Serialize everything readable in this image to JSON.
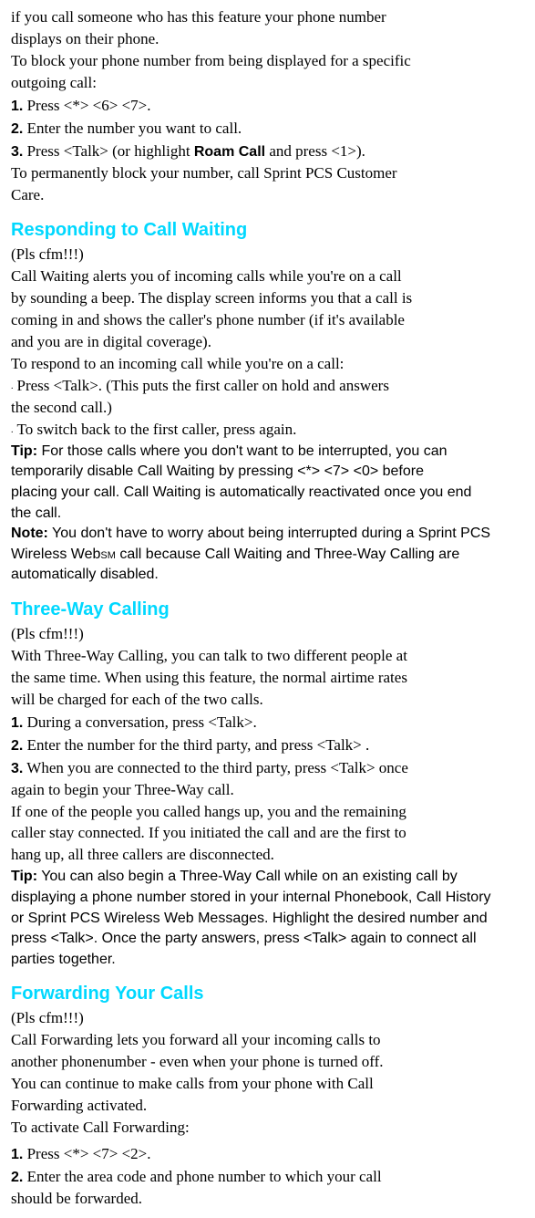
{
  "intro": {
    "l1": "if you call someone who has this feature your phone number",
    "l2": "displays on their phone.",
    "l3": "To block your phone number from being displayed for a specific",
    "l4": "outgoing call:",
    "s1n": "1.",
    "s1t": " Press <*> <6> <7>.",
    "s2n": "2.",
    "s2t": " Enter the number you want to call.",
    "s3n": "3.",
    "s3ta": " Press <Talk> (or highlight ",
    "s3tb": "Roam Call",
    "s3tc": " and press <1>).",
    "l5": "To permanently block your number, call Sprint PCS Customer",
    "l6": "Care."
  },
  "cw": {
    "heading": "Responding to Call Waiting",
    "pls": "(Pls cfm!!!)",
    "l1": "Call Waiting alerts you of incoming calls while you're on a call",
    "l2": "by sounding a beep. The display screen informs you that a call is",
    "l3": "coming in and shows the caller's phone number (if it's available",
    "l4": "and you are in digital coverage).",
    "l5": "To respond to an incoming call while you're on a call:",
    "b1a": "Press <Talk>. (This puts the first caller on hold and answers",
    "b1b": "the second call.)",
    "b2": "To switch back to the first caller, press again.",
    "tiplabel": "Tip:",
    "tip1": " For those calls where you don't want to be interrupted, you can",
    "tip2": "temporarily disable Call Waiting by pressing <*> <7> <0> before",
    "tip3": "placing your call. Call Waiting is automatically reactivated once you end",
    "tip4": "the call.",
    "notelabel": "Note:",
    "note1": " You don't have to worry about being interrupted during a Sprint PCS",
    "note2a": "Wireless Web",
    "note2sm": "SM",
    "note2b": " call because Call Waiting and Three-Way Calling are",
    "note3": "automatically disabled."
  },
  "tw": {
    "heading": "Three-Way Calling",
    "pls": "(Pls cfm!!!)",
    "l1": "With Three-Way Calling, you can talk to two different people at",
    "l2": "the same time. When using this feature, the normal airtime rates",
    "l3": "will be charged for each of the two calls.",
    "s1n": "1.",
    "s1t": " During a conversation, press <Talk>.",
    "s2n": "2.",
    "s2t": " Enter the number for the third party, and press <Talk> .",
    "s3n": "3.",
    "s3ta": " When you are connected to the third party, press <Talk> once",
    "s3tb": "again to begin your Three-Way call.",
    "l4": "If one of the people you called hangs up, you and the remaining",
    "l5": "caller stay connected. If you initiated the call and are the first to",
    "l6": "hang up, all three callers are disconnected.",
    "tiplabel": "Tip:",
    "tip1": " You can also begin a Three-Way Call while on an existing call by",
    "tip2": "displaying a phone number stored in your internal Phonebook, Call History",
    "tip3": "or Sprint PCS Wireless Web Messages. Highlight the desired number and",
    "tip4": "press <Talk>. Once the party answers, press <Talk> again to connect all",
    "tip5": "parties together."
  },
  "fw": {
    "heading": "Forwarding Your Calls",
    "pls": "(Pls cfm!!!)",
    "l1": "Call Forwarding lets you forward all your incoming calls to",
    "l2": "another phonenumber - even when your phone is turned off.",
    "l3": "You can continue to make calls from your phone with Call",
    "l4": "Forwarding activated.",
    "l5": "To activate Call Forwarding:",
    "s1n": "1.",
    "s1t": " Press <*> <7> <2>.",
    "s2n": "2.",
    "s2ta": " Enter the area code and phone number to which your call",
    "s2tb": "should be forwarded."
  }
}
